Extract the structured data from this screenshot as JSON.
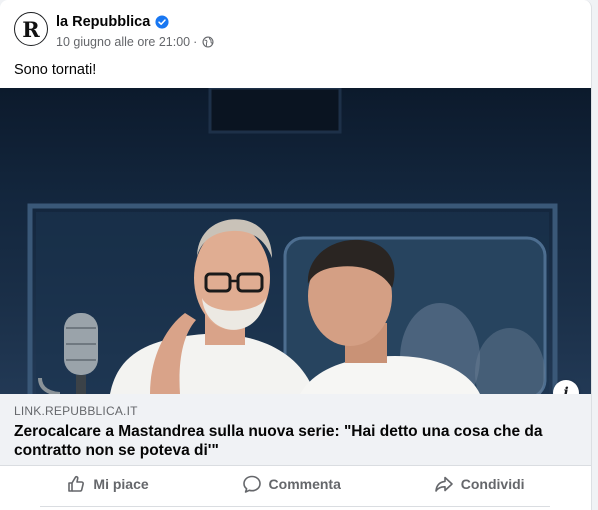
{
  "post": {
    "page_name": "la Repubblica",
    "avatar_letter": "R",
    "timestamp": "10 giugno alle ore 21:00",
    "separator": "·",
    "text": "Sono tornati!",
    "verified_icon": "verified-badge-icon",
    "audience_icon": "globe-icon"
  },
  "link_preview": {
    "domain": "LINK.REPUBBLICA.IT",
    "title": "Zerocalcare a Mastandrea sulla nuova serie: \"Hai detto una cosa che da contratto non se poteva di'\"",
    "info_label": "i"
  },
  "actions": {
    "like": "Mi piace",
    "comment": "Commenta",
    "share": "Condividi"
  },
  "colors": {
    "verified": "#1877f2",
    "secondary_text": "#65676b",
    "link_box_bg": "#f0f2f5"
  }
}
